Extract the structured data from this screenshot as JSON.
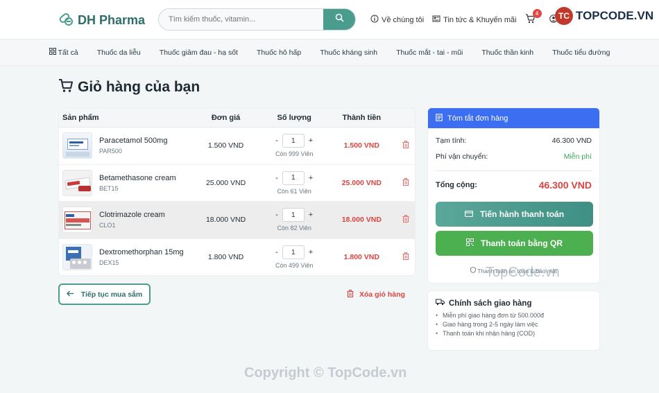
{
  "header": {
    "brand": "DH Pharma",
    "search_placeholder": "Tìm kiếm thuốc, vitamin...",
    "links": {
      "about": "Về chúng tôi",
      "news": "Tin tức & Khuyến mãi"
    },
    "cart_count": "4",
    "watermark_brand": "TOPCODE.VN",
    "watermark_badge": "TC"
  },
  "categories": [
    "Tất cả",
    "Thuốc da liễu",
    "Thuốc giảm đau - hạ sốt",
    "Thuốc hô hấp",
    "Thuốc kháng sinh",
    "Thuốc mắt - tai - mũi",
    "Thuốc thần kinh",
    "Thuốc tiểu đường"
  ],
  "page": {
    "title": "Giỏ hàng của bạn"
  },
  "cart": {
    "columns": [
      "Sản phẩm",
      "Đơn giá",
      "Số lượng",
      "Thành tiền"
    ],
    "items": [
      {
        "name": "Paracetamol 500mg",
        "code": "PAR500",
        "price": "1.500 VND",
        "qty": "1",
        "stock": "Còn 999 Viên",
        "total": "1.500 VND"
      },
      {
        "name": "Betamethasone cream",
        "code": "BET15",
        "price": "25.000 VND",
        "qty": "1",
        "stock": "Còn 61 Viên",
        "total": "25.000 VND"
      },
      {
        "name": "Clotrimazole cream",
        "code": "CLO1",
        "price": "18.000 VND",
        "qty": "1",
        "stock": "Còn 82 Viên",
        "total": "18.000 VND"
      },
      {
        "name": "Dextromethorphan 15mg",
        "code": "DEX15",
        "price": "1.800 VND",
        "qty": "1",
        "stock": "Còn 499 Viên",
        "total": "1.800 VND"
      }
    ],
    "minus": "-",
    "plus": "+",
    "continue_label": "Tiếp tục mua sắm",
    "clear_label": "Xóa giỏ hàng"
  },
  "summary": {
    "title": "Tóm tắt đơn hàng",
    "subtotal_label": "Tạm tính:",
    "subtotal_value": "46.300 VND",
    "shipping_label": "Phí vận chuyển:",
    "shipping_value": "Miễn phí",
    "total_label": "Tổng cộng:",
    "total_value": "46.300 VND",
    "checkout_label": "Tiến hành thanh toán",
    "qr_label": "Thanh toán bằng QR",
    "secure_note": "Thanh toán an toàn & bảo mật"
  },
  "policy": {
    "title": "Chính sách giao hàng",
    "items": [
      "Miễn phí giao hàng đơn từ 500.000đ",
      "Giao hàng trong 2-5 ngày làm việc",
      "Thanh toán khi nhận hàng (COD)"
    ]
  },
  "watermarks": {
    "mid": "TopCode.vn",
    "bottom": "Copyright © TopCode.vn"
  },
  "colors": {
    "brand": "#2e6e68",
    "accent": "#4a9c8c",
    "summary_header": "#3b6ef0",
    "price_red": "#d9443f",
    "free_green": "#3aa655",
    "qr_green": "#4caf50"
  }
}
